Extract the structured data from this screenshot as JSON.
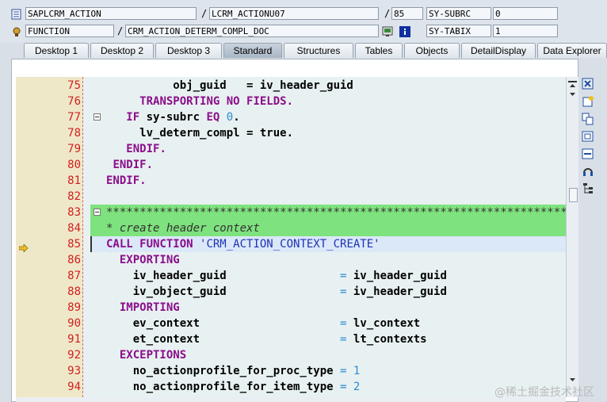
{
  "header": {
    "row1": {
      "program": "SAPLCRM_ACTION",
      "include": "LCRM_ACTIONU07",
      "line_no": "85",
      "var_name": "SY-SUBRC",
      "var_value": "0"
    },
    "row2": {
      "type": "FUNCTION",
      "event": "CRM_ACTION_DETERM_COMPL_DOC",
      "var_name": "SY-TABIX",
      "var_value": "1"
    },
    "slash": "/"
  },
  "tabs": [
    {
      "label": "Desktop 1"
    },
    {
      "label": "Desktop 2"
    },
    {
      "label": "Desktop 3"
    },
    {
      "label": "Standard",
      "active": true
    },
    {
      "label": "Structures"
    },
    {
      "label": "Tables"
    },
    {
      "label": "Objects"
    },
    {
      "label": "DetailDisplay"
    },
    {
      "label": "Data Explorer"
    }
  ],
  "code_lines": [
    {
      "no": "75",
      "fold": false,
      "arrow": false,
      "hl": "",
      "segs": [
        [
          "",
          "          obj_guid   = iv_header_guid",
          "bold"
        ]
      ]
    },
    {
      "no": "76",
      "fold": false,
      "arrow": false,
      "hl": "",
      "segs": [
        [
          "",
          "     ",
          ""
        ],
        [
          "TRANSPORTING NO FIELDS.",
          "",
          "kw"
        ]
      ]
    },
    {
      "no": "77",
      "fold": true,
      "arrow": false,
      "hl": "",
      "segs": [
        [
          "",
          "   ",
          ""
        ],
        [
          "IF",
          "",
          "kw"
        ],
        [
          " sy-subrc ",
          "",
          "bold"
        ],
        [
          "EQ",
          "",
          "kw"
        ],
        [
          " ",
          "",
          ""
        ],
        [
          "0",
          "",
          "nm"
        ],
        [
          ".",
          "",
          "bold"
        ]
      ]
    },
    {
      "no": "78",
      "fold": false,
      "arrow": false,
      "hl": "",
      "segs": [
        [
          "",
          "     lv_determ_compl = true.",
          "bold"
        ]
      ]
    },
    {
      "no": "79",
      "fold": false,
      "arrow": false,
      "hl": "",
      "segs": [
        [
          "",
          "   ",
          ""
        ],
        [
          "ENDIF.",
          "",
          "kw"
        ]
      ]
    },
    {
      "no": "80",
      "fold": false,
      "arrow": false,
      "hl": "",
      "segs": [
        [
          "",
          " ",
          ""
        ],
        [
          "ENDIF.",
          "",
          "kw"
        ]
      ]
    },
    {
      "no": "81",
      "fold": false,
      "arrow": false,
      "hl": "",
      "segs": [
        [
          "",
          "",
          ""
        ],
        [
          "ENDIF.",
          "",
          "kw"
        ]
      ]
    },
    {
      "no": "82",
      "fold": false,
      "arrow": false,
      "hl": "",
      "segs": [
        [
          "",
          "",
          ""
        ]
      ]
    },
    {
      "no": "83",
      "fold": true,
      "arrow": false,
      "hl": "green",
      "segs": [
        [
          "",
          "*********************************************************************",
          "cm"
        ]
      ]
    },
    {
      "no": "84",
      "fold": false,
      "arrow": false,
      "hl": "green",
      "segs": [
        [
          "",
          "* create header context",
          "cm"
        ]
      ]
    },
    {
      "no": "85",
      "fold": false,
      "arrow": true,
      "hl": "current",
      "segs": [
        [
          "",
          "",
          ""
        ],
        [
          "CALL FUNCTION",
          "",
          "kw"
        ],
        [
          " ",
          "",
          ""
        ],
        [
          "'CRM_ACTION_CONTEXT_CREATE'",
          "",
          "str"
        ]
      ]
    },
    {
      "no": "86",
      "fold": false,
      "arrow": false,
      "hl": "",
      "segs": [
        [
          "",
          "  ",
          ""
        ],
        [
          "EXPORTING",
          "",
          "kw"
        ]
      ]
    },
    {
      "no": "87",
      "fold": false,
      "arrow": false,
      "hl": "",
      "segs": [
        [
          "",
          "    iv_header_guid",
          "bold"
        ],
        [
          "",
          "                 ",
          ""
        ],
        [
          "=",
          "",
          "op"
        ],
        [
          " iv_header_guid",
          "",
          "bold"
        ]
      ]
    },
    {
      "no": "88",
      "fold": false,
      "arrow": false,
      "hl": "",
      "segs": [
        [
          "",
          "    iv_object_guid",
          "bold"
        ],
        [
          "",
          "                 ",
          ""
        ],
        [
          "=",
          "",
          "op"
        ],
        [
          " iv_header_guid",
          "",
          "bold"
        ]
      ]
    },
    {
      "no": "89",
      "fold": false,
      "arrow": false,
      "hl": "",
      "segs": [
        [
          "",
          "  ",
          ""
        ],
        [
          "IMPORTING",
          "",
          "kw"
        ]
      ]
    },
    {
      "no": "90",
      "fold": false,
      "arrow": false,
      "hl": "",
      "segs": [
        [
          "",
          "    ev_context",
          "bold"
        ],
        [
          "",
          "                     ",
          ""
        ],
        [
          "=",
          "",
          "op"
        ],
        [
          " lv_context",
          "",
          "bold"
        ]
      ]
    },
    {
      "no": "91",
      "fold": false,
      "arrow": false,
      "hl": "",
      "segs": [
        [
          "",
          "    et_context",
          "bold"
        ],
        [
          "",
          "                     ",
          ""
        ],
        [
          "=",
          "",
          "op"
        ],
        [
          " lt_contexts",
          "",
          "bold"
        ]
      ]
    },
    {
      "no": "92",
      "fold": false,
      "arrow": false,
      "hl": "",
      "segs": [
        [
          "",
          "  ",
          ""
        ],
        [
          "EXCEPTIONS",
          "",
          "kw"
        ]
      ]
    },
    {
      "no": "93",
      "fold": false,
      "arrow": false,
      "hl": "",
      "segs": [
        [
          "",
          "    no_actionprofile_for_proc_type",
          "bold"
        ],
        [
          "",
          " ",
          ""
        ],
        [
          "=",
          "",
          "op"
        ],
        [
          " ",
          "",
          ""
        ],
        [
          "1",
          "",
          "nm"
        ]
      ]
    },
    {
      "no": "94",
      "fold": false,
      "arrow": false,
      "hl": "",
      "segs": [
        [
          "",
          "    no_actionprofile_for_item_type",
          "bold"
        ],
        [
          "",
          " ",
          ""
        ],
        [
          "=",
          "",
          "op"
        ],
        [
          " ",
          "",
          ""
        ],
        [
          "2",
          "",
          "nm"
        ]
      ]
    }
  ],
  "right_toolbar": [
    "close-icon",
    "new-page-icon",
    "copy-icon",
    "fullscreen-icon",
    "resize-icon",
    "headset-icon",
    "tree-icon"
  ],
  "watermark": "@稀土掘金技术社区",
  "colors": {
    "keyword": "#8b0e8b",
    "number": "#2a8ad0",
    "string": "#1e32b4",
    "line_number": "#d02020",
    "comment_highlight": "#7ee27e",
    "current_line": "#dbe8f8"
  }
}
